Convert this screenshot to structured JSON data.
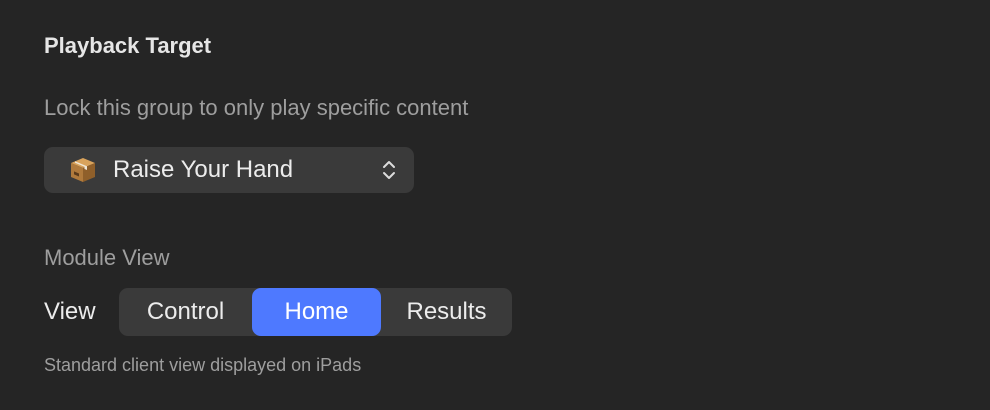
{
  "playback_target": {
    "title": "Playback Target",
    "description": "Lock this group to only play specific content",
    "selected_content": {
      "icon": "package-box-icon",
      "label": "Raise Your Hand"
    }
  },
  "module_view": {
    "heading": "Module View",
    "view_label": "View",
    "segments": [
      {
        "label": "Control",
        "selected": false
      },
      {
        "label": "Home",
        "selected": true
      },
      {
        "label": "Results",
        "selected": false
      }
    ],
    "help_text": "Standard client view displayed on iPads"
  },
  "colors": {
    "background": "#252525",
    "control_bg": "#3a3a3a",
    "accent": "#4e79ff"
  }
}
